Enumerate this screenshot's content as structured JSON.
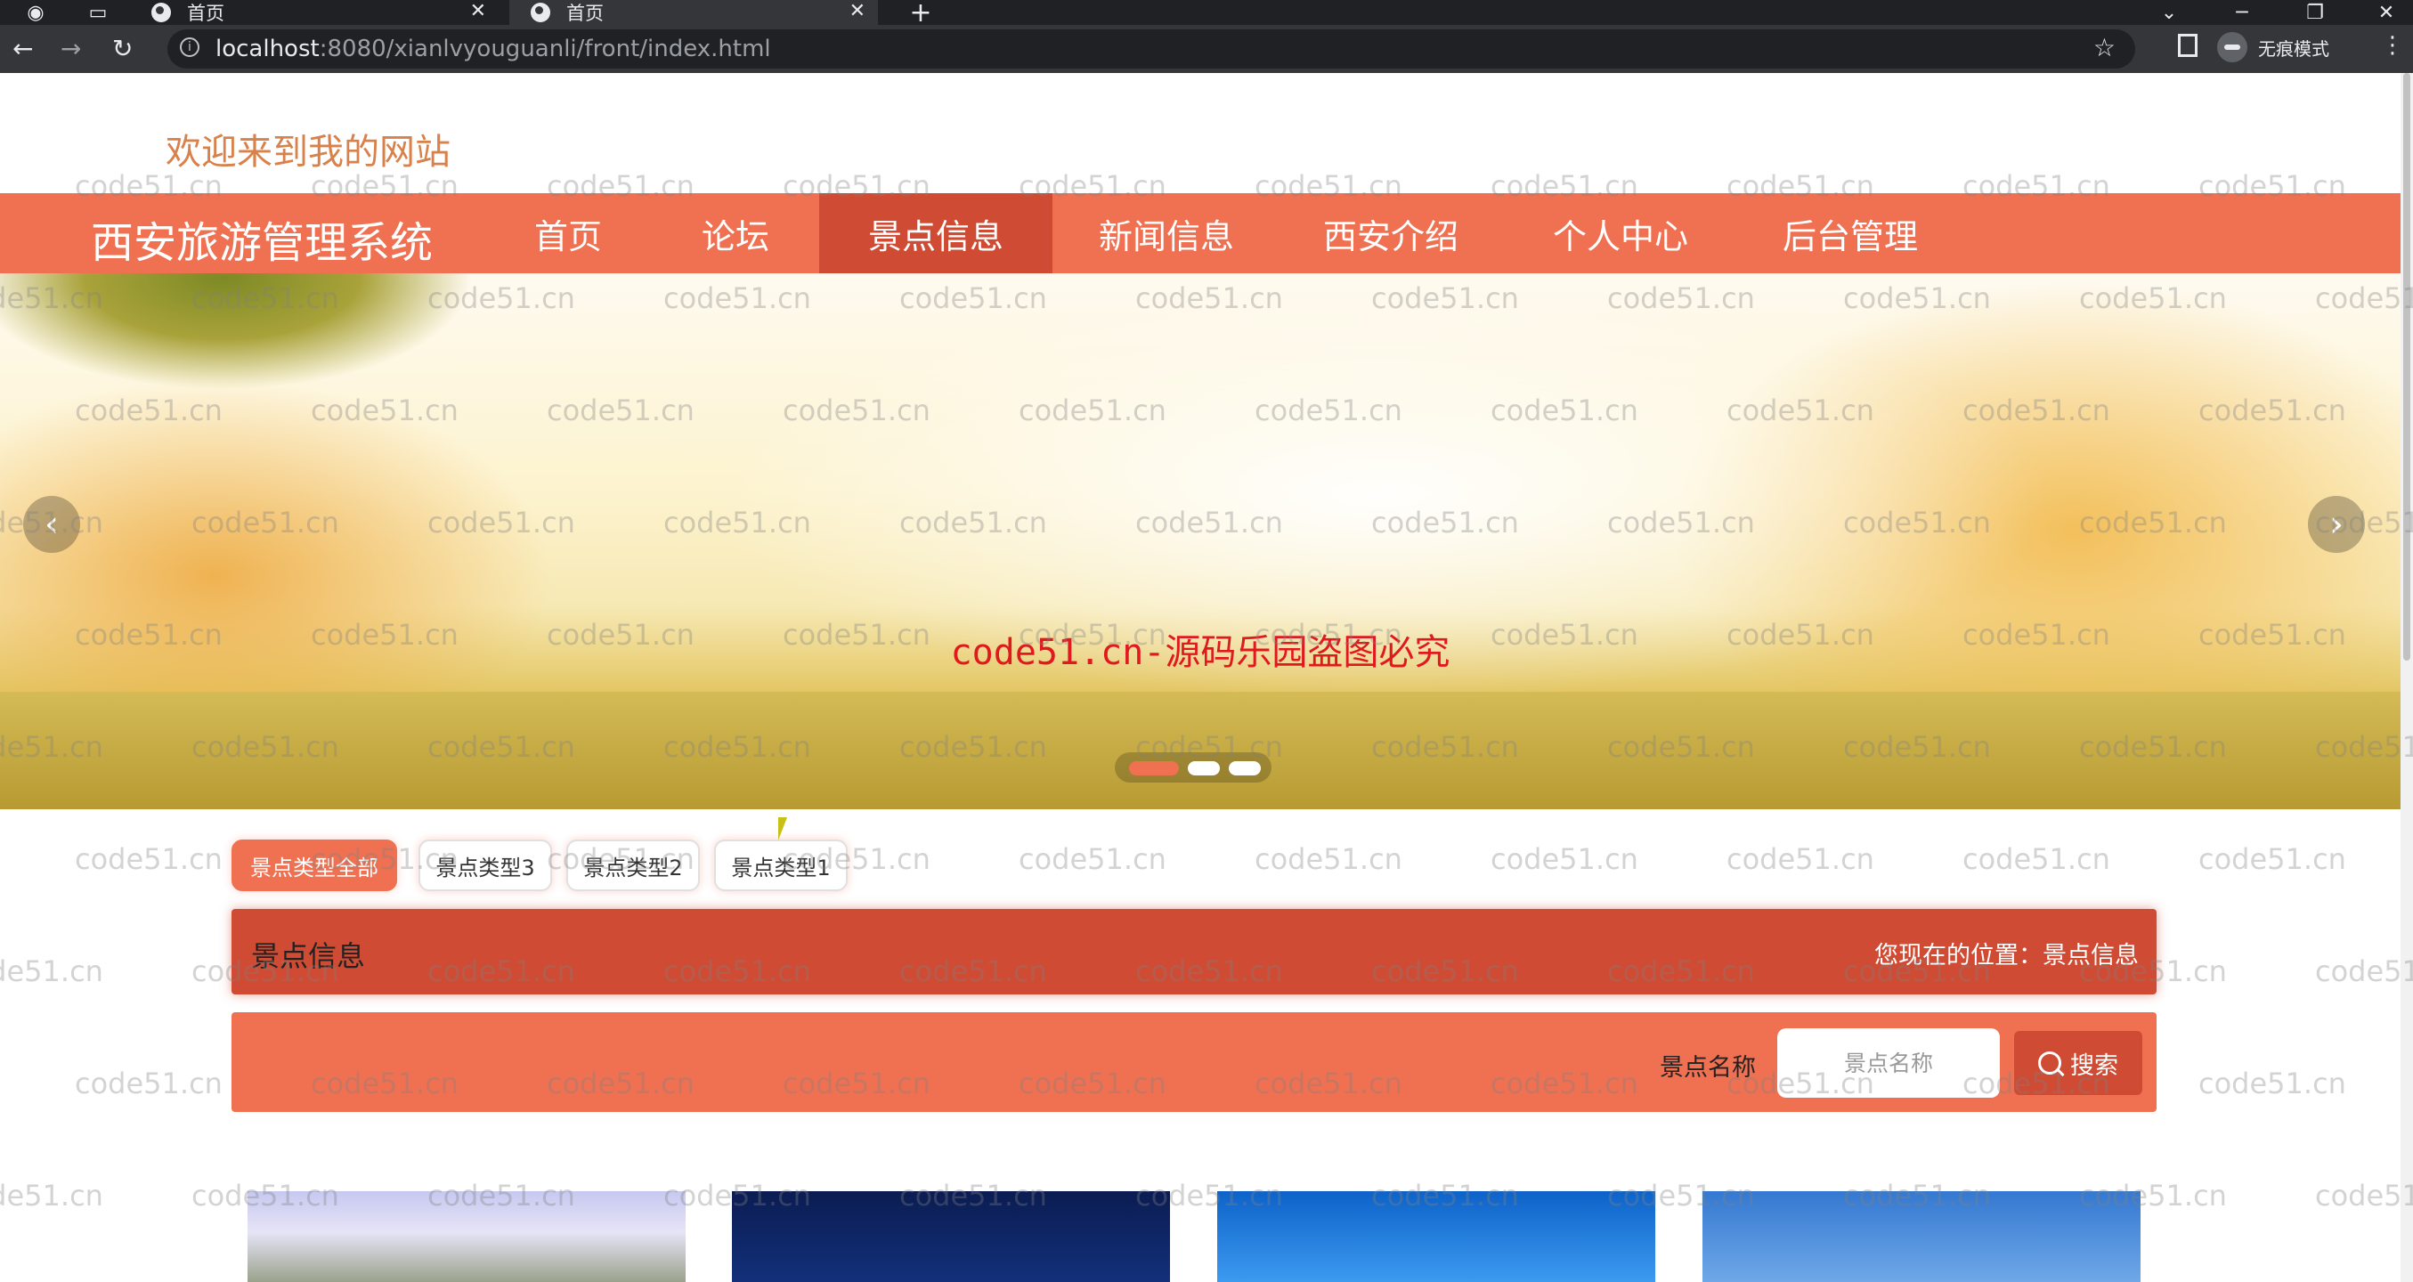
{
  "browser": {
    "tabs": [
      {
        "title": "首页",
        "active": false
      },
      {
        "title": "首页",
        "active": true
      }
    ],
    "new_tab_label": "+",
    "url_host": "localhost",
    "url_rest": ":8080/xianlvyouguanli/front/index.html",
    "incognito_label": "无痕模式",
    "window_controls": {
      "minimize": "─",
      "restore": "❐",
      "close": "✕",
      "dropdown": "⌄"
    }
  },
  "header": {
    "welcome": "欢迎来到我的网站",
    "brand": "西安旅游管理系统"
  },
  "nav": {
    "items": [
      {
        "label": "首页",
        "active": false
      },
      {
        "label": "论坛",
        "active": false
      },
      {
        "label": "景点信息",
        "active": true
      },
      {
        "label": "新闻信息",
        "active": false
      },
      {
        "label": "西安介绍",
        "active": false
      },
      {
        "label": "个人中心",
        "active": false
      },
      {
        "label": "后台管理",
        "active": false
      }
    ]
  },
  "banner": {
    "caption": "code51.cn-源码乐园盗图必究",
    "prev_arrow": "‹",
    "next_arrow": "›",
    "slide_count": 3,
    "active_slide": 1
  },
  "types": [
    {
      "label": "景点类型全部",
      "active": true
    },
    {
      "label": "景点类型3",
      "active": false
    },
    {
      "label": "景点类型2",
      "active": false
    },
    {
      "label": "景点类型1",
      "active": false
    }
  ],
  "section": {
    "title": "景点信息",
    "location": "您现在的位置：景点信息"
  },
  "search": {
    "label": "景点名称",
    "placeholder": "景点名称",
    "button": "搜索"
  },
  "watermark": "code51.cn",
  "colors": {
    "primary": "#ef7152",
    "primary_dark": "#d04b33",
    "welcome": "#d8814a",
    "caption": "#e0191e"
  }
}
